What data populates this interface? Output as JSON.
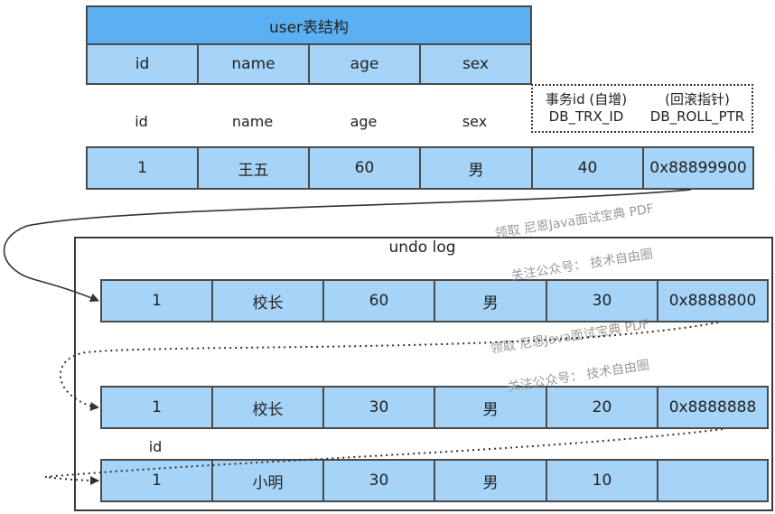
{
  "table_title": "user表结构",
  "header_cells": [
    "id",
    "name",
    "age",
    "sex"
  ],
  "column_labels": [
    "id",
    "name",
    "age",
    "sex"
  ],
  "hidden_columns": {
    "trx_line1": "事务id (自增)",
    "trx_line2": "DB_TRX_ID",
    "roll_line1": "(回滚指针)",
    "roll_line2": "DB_ROLL_PTR"
  },
  "current_row": [
    "1",
    "王五",
    "60",
    "男",
    "40",
    "0x88899900"
  ],
  "undo_log": {
    "title": "undo log",
    "rows": [
      [
        "1",
        "校长",
        "60",
        "男",
        "30",
        "0x8888800"
      ],
      [
        "1",
        "校长",
        "30",
        "男",
        "20",
        "0x8888888"
      ],
      [
        "1",
        "小明",
        "30",
        "男",
        "10",
        ""
      ]
    ],
    "id_label": "id"
  },
  "watermarks": {
    "line1": "领取 尼恩Java面试宝典 PDF",
    "line2": "关注公众号： 技术自由圈"
  }
}
